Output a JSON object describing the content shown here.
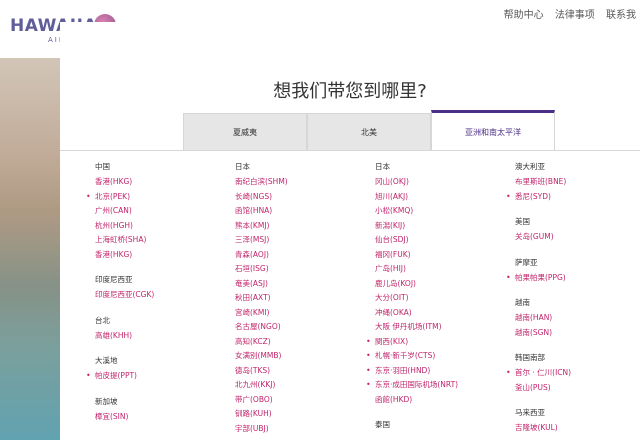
{
  "header": {
    "logo_text": "HAWAIIAN",
    "logo_sub": "AIRLINES",
    "links": [
      "帮助中心",
      "法律事项",
      "联系我"
    ]
  },
  "modal": {
    "title": "想我们带您到哪里?",
    "tabs": [
      "夏威夷",
      "北美",
      "亚洲和南太平洋"
    ],
    "active_tab": 2
  },
  "columns": [
    [
      {
        "country": "中国",
        "cities": [
          {
            "label": "香港(HKG)",
            "bullet": false
          },
          {
            "label": "北京(PEK)",
            "bullet": true
          },
          {
            "label": "广州(CAN)",
            "bullet": false
          },
          {
            "label": "杭州(HGH)",
            "bullet": false
          },
          {
            "label": "上海虹桥(SHA)",
            "bullet": false
          },
          {
            "label": "香港(HKG)",
            "bullet": false
          }
        ]
      },
      {
        "country": "印度尼西亚",
        "cities": [
          {
            "label": "印度尼西亚(CGK)",
            "bullet": false
          }
        ]
      },
      {
        "country": "台北",
        "cities": [
          {
            "label": "高雄(KHH)",
            "bullet": false
          }
        ]
      },
      {
        "country": "大溪地",
        "cities": [
          {
            "label": "帕皮提(PPT)",
            "bullet": true
          }
        ]
      },
      {
        "country": "新加坡",
        "cities": [
          {
            "label": "樟宜(SIN)",
            "bullet": false
          }
        ]
      }
    ],
    [
      {
        "country": "日本",
        "cities": [
          {
            "label": "南纪白滨(SHM)",
            "bullet": false
          },
          {
            "label": "长崎(NGS)",
            "bullet": false
          },
          {
            "label": "函馆(HNA)",
            "bullet": false
          },
          {
            "label": "熊本(KMJ)",
            "bullet": false
          },
          {
            "label": "三泽(MSJ)",
            "bullet": false
          },
          {
            "label": "青森(AOJ)",
            "bullet": false
          },
          {
            "label": "石垣(ISG)",
            "bullet": false
          },
          {
            "label": "奄美(ASJ)",
            "bullet": false
          },
          {
            "label": "秋田(AXT)",
            "bullet": false
          },
          {
            "label": "宫崎(KMI)",
            "bullet": false
          },
          {
            "label": "名古屋(NGO)",
            "bullet": false
          },
          {
            "label": "高知(KCZ)",
            "bullet": false
          },
          {
            "label": "女满别(MMB)",
            "bullet": false
          },
          {
            "label": "德岛(TKS)",
            "bullet": false
          },
          {
            "label": "北九州(KKJ)",
            "bullet": false
          },
          {
            "label": "带广(OBO)",
            "bullet": false
          },
          {
            "label": "钏路(KUH)",
            "bullet": false
          },
          {
            "label": "宇部(UBJ)",
            "bullet": false
          }
        ]
      }
    ],
    [
      {
        "country": "日本",
        "cities": [
          {
            "label": "冈山(OKJ)",
            "bullet": false
          },
          {
            "label": "旭川(AKJ)",
            "bullet": false
          },
          {
            "label": "小松(KMQ)",
            "bullet": false
          },
          {
            "label": "新潟(KIJ)",
            "bullet": false
          },
          {
            "label": "仙台(SDJ)",
            "bullet": false
          },
          {
            "label": "福冈(FUK)",
            "bullet": false
          },
          {
            "label": "广岛(HIJ)",
            "bullet": false
          },
          {
            "label": "鹿儿岛(KOJ)",
            "bullet": false
          },
          {
            "label": "大分(OIT)",
            "bullet": false
          },
          {
            "label": "冲绳(OKA)",
            "bullet": false
          },
          {
            "label": "大阪 伊丹机场(ITM)",
            "bullet": false
          },
          {
            "label": "関西(KIX)",
            "bullet": true
          },
          {
            "label": "札幌·新千岁(CTS)",
            "bullet": true
          },
          {
            "label": "东京·羽田(HND)",
            "bullet": true
          },
          {
            "label": "东京·成田国际机场(NRT)",
            "bullet": true
          },
          {
            "label": "函館(HKD)",
            "bullet": false
          }
        ]
      },
      {
        "country": "泰国",
        "cities": []
      }
    ],
    [
      {
        "country": "澳大利亚",
        "cities": [
          {
            "label": "布里斯班(BNE)",
            "bullet": false
          },
          {
            "label": "悉尼(SYD)",
            "bullet": true
          }
        ]
      },
      {
        "country": "美国",
        "cities": [
          {
            "label": "关岛(GUM)",
            "bullet": false
          }
        ]
      },
      {
        "country": "萨摩亚",
        "cities": [
          {
            "label": "帕果帕果(PPG)",
            "bullet": true
          }
        ]
      },
      {
        "country": "越南",
        "cities": [
          {
            "label": "越南(HAN)",
            "bullet": false
          },
          {
            "label": "越南(SGN)",
            "bullet": false
          }
        ]
      },
      {
        "country": "韩国南部",
        "cities": [
          {
            "label": "首尔 · 仁川(ICN)",
            "bullet": true
          },
          {
            "label": "釜山(PUS)",
            "bullet": false
          }
        ]
      },
      {
        "country": "马来西亚",
        "cities": [
          {
            "label": "吉隆坡(KUL)",
            "bullet": false
          }
        ]
      }
    ]
  ],
  "colors": {
    "brand_purple": "#4b2f86",
    "link_magenta": "#c0246b",
    "logo_navy": "#3d3a86"
  }
}
